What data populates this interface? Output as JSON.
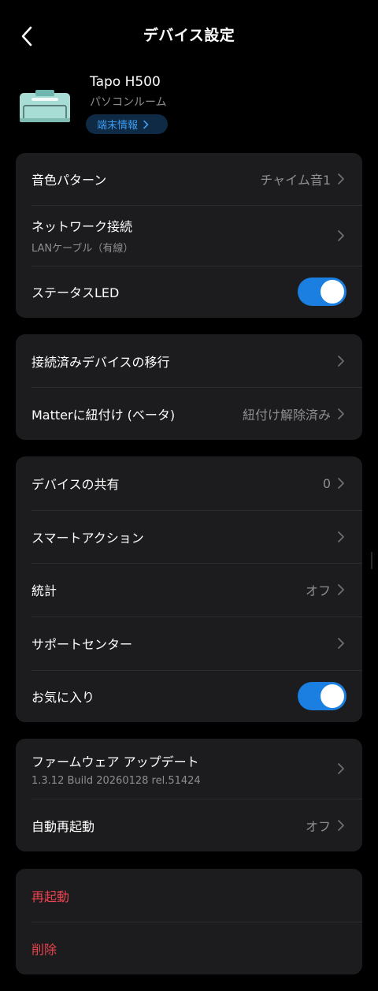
{
  "header": {
    "title": "デバイス設定"
  },
  "device": {
    "name": "Tapo H500",
    "room": "パソコンルーム",
    "info_label": "端末情報"
  },
  "card1": {
    "chime": {
      "label": "音色パターン",
      "value": "チャイム音1"
    },
    "network": {
      "label": "ネットワーク接続",
      "sub": "LANケーブル（有線）"
    },
    "status_led": {
      "label": "ステータスLED",
      "on": true
    }
  },
  "card2": {
    "migrate": {
      "label": "接続済みデバイスの移行"
    },
    "matter": {
      "label": "Matterに紐付け (ベータ)",
      "value": "紐付け解除済み"
    }
  },
  "card3": {
    "share": {
      "label": "デバイスの共有",
      "value": "0"
    },
    "smart_action": {
      "label": "スマートアクション"
    },
    "stats": {
      "label": "統計",
      "value": "オフ"
    },
    "support": {
      "label": "サポートセンター"
    },
    "favorite": {
      "label": "お気に入り",
      "on": true
    }
  },
  "card4": {
    "firmware": {
      "label": "ファームウェア アップデート",
      "sub": "1.3.12 Build 20260128 rel.51424"
    },
    "auto_reboot": {
      "label": "自動再起動",
      "value": "オフ"
    }
  },
  "card5": {
    "reboot": {
      "label": "再起動"
    },
    "delete": {
      "label": "削除"
    }
  },
  "colors": {
    "accent": "#1a7fe0",
    "danger": "#e8434f",
    "card": "#1c1c1e",
    "muted": "#8e8e93"
  }
}
